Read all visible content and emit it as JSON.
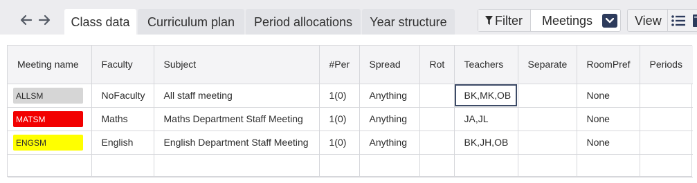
{
  "nav": {
    "back_icon": "arrow-left-icon",
    "forward_icon": "arrow-right-icon"
  },
  "tabs": [
    {
      "label": "Class data",
      "active": true
    },
    {
      "label": "Curriculum plan",
      "active": false
    },
    {
      "label": "Period allocations",
      "active": false
    },
    {
      "label": "Year structure",
      "active": false
    }
  ],
  "filter": {
    "label": "Filter",
    "selected": "Meetings"
  },
  "view": {
    "label": "View"
  },
  "table": {
    "columns": [
      "Meeting name",
      "Faculty",
      "Subject",
      "#Per",
      "Spread",
      "Rot",
      "Teachers",
      "Separate",
      "RoomPref",
      "Periods"
    ],
    "rows": [
      {
        "name": "ALLSM",
        "color": "#d6d6d6",
        "text_color": "#2b2b2b",
        "faculty": "NoFaculty",
        "subject": "All staff meeting",
        "per": "1(0)",
        "spread": "Anything",
        "rot": "",
        "teachers": "BK,MK,OB",
        "separate": "",
        "roompref": "None",
        "periods": ""
      },
      {
        "name": "MATSM",
        "color": "#f20000",
        "text_color": "#ffffff",
        "faculty": "Maths",
        "subject": "Maths Department Staff Meeting",
        "per": "1(0)",
        "spread": "Anything",
        "rot": "",
        "teachers": "JA,JL",
        "separate": "",
        "roompref": "None",
        "periods": ""
      },
      {
        "name": "ENGSM",
        "color": "#ffff00",
        "text_color": "#2b2b2b",
        "faculty": "English",
        "subject": "English Department Staff Meeting",
        "per": "1(0)",
        "spread": "Anything",
        "rot": "",
        "teachers": "BK,JH,OB",
        "separate": "",
        "roompref": "None",
        "periods": ""
      },
      {
        "name": "",
        "color": "",
        "text_color": "",
        "faculty": "",
        "subject": "",
        "per": "",
        "spread": "",
        "rot": "",
        "teachers": "",
        "separate": "",
        "roompref": "",
        "periods": ""
      }
    ]
  }
}
